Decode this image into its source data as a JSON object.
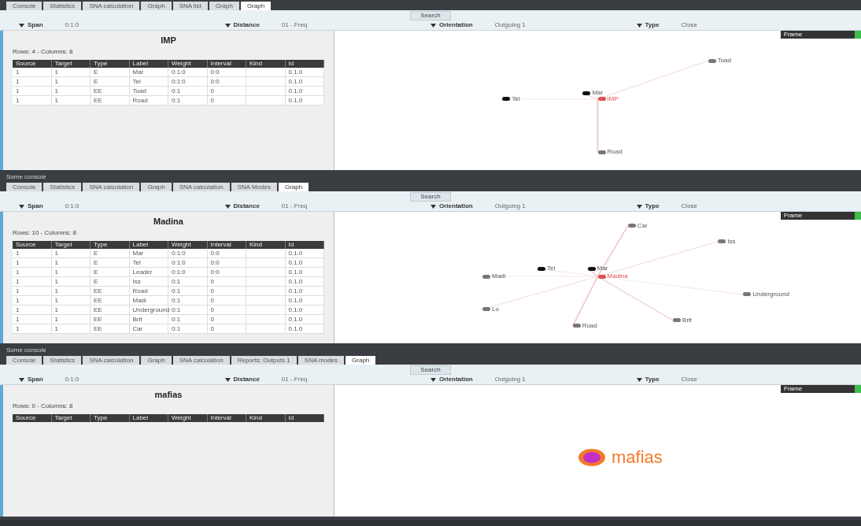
{
  "panels": [
    {
      "tabs": [
        {
          "label": "Console",
          "selected": false
        },
        {
          "label": "Statistics",
          "selected": false
        },
        {
          "label": "SNA calculation",
          "selected": false
        },
        {
          "label": "Graph",
          "selected": false
        },
        {
          "label": "SNA list",
          "selected": false
        },
        {
          "label": "Graph",
          "selected": false
        },
        {
          "label": "Graph",
          "selected": true
        }
      ],
      "search_button": "Search",
      "filters": [
        {
          "label": "Span",
          "value": "0:1:0"
        },
        {
          "label": "Distance",
          "value": "01 - Freq"
        },
        {
          "label": "Orientation",
          "value": "Outgoing 1"
        },
        {
          "label": "Type",
          "value": "Close"
        }
      ],
      "frame_label": "Frame",
      "heading": "IMP",
      "summary": "Rows: 4 - Columns: 8",
      "columns": [
        "Source",
        "Target",
        "Type",
        "Label",
        "Weight",
        "Interval",
        "Kind",
        "Id"
      ],
      "rows": [
        [
          "1",
          "1",
          "E",
          "Mar",
          "0:1:0",
          "0:0",
          "",
          "0.1.0"
        ],
        [
          "1",
          "1",
          "E",
          "Tel",
          "0:1:0",
          "0:0",
          "",
          "0.1.0"
        ],
        [
          "1",
          "1",
          "EE",
          "Toad",
          "0:1",
          "0",
          "",
          "0.1.0"
        ],
        [
          "1",
          "1",
          "EE",
          "Road",
          "0:1",
          "0",
          "",
          "0.1.0"
        ]
      ],
      "nodes": [
        {
          "label": "Toad",
          "kind": "grey"
        },
        {
          "label": "Mar",
          "kind": "dark"
        },
        {
          "label": "Tel",
          "kind": "dark"
        },
        {
          "label": "Road",
          "kind": "grey"
        },
        {
          "label": "IMP",
          "kind": "center"
        }
      ]
    },
    {
      "console_title": "Some console",
      "tabs": [
        {
          "label": "Console",
          "selected": false
        },
        {
          "label": "Statistics",
          "selected": false
        },
        {
          "label": "SNA calculation",
          "selected": false
        },
        {
          "label": "Graph",
          "selected": false
        },
        {
          "label": "SNA calculation",
          "selected": false
        },
        {
          "label": "SNA Modes",
          "selected": false
        },
        {
          "label": "Graph",
          "selected": true
        }
      ],
      "search_button": "Search",
      "filters": [
        {
          "label": "Span",
          "value": "0:1:0"
        },
        {
          "label": "Distance",
          "value": "01 - Freq"
        },
        {
          "label": "Orientation",
          "value": "Outgoing 1"
        },
        {
          "label": "Type",
          "value": "Close"
        }
      ],
      "frame_label": "Frame",
      "heading": "Madina",
      "summary": "Rows: 10 - Columns: 8",
      "columns": [
        "Source",
        "Target",
        "Type",
        "Label",
        "Weight",
        "Interval",
        "Kind",
        "Id"
      ],
      "rows": [
        [
          "1",
          "1",
          "E",
          "Mar",
          "0:1:0",
          "0:0",
          "",
          "0.1.0"
        ],
        [
          "1",
          "1",
          "E",
          "Tel",
          "0:1:0",
          "0:0",
          "",
          "0.1.0"
        ],
        [
          "1",
          "1",
          "E",
          "Leader",
          "0:1:0",
          "0:0",
          "",
          "0.1.0"
        ],
        [
          "1",
          "1",
          "E",
          "Iss",
          "0:1",
          "0",
          "",
          "0.1.0"
        ],
        [
          "1",
          "1",
          "EE",
          "Road",
          "0:1",
          "0",
          "",
          "0.1.0"
        ],
        [
          "1",
          "1",
          "EE",
          "Madi",
          "0:1",
          "0",
          "",
          "0.1.0"
        ],
        [
          "1",
          "1",
          "EE",
          "Underground",
          "0:1",
          "0",
          "",
          "0.1.0"
        ],
        [
          "1",
          "1",
          "EE",
          "Brit",
          "0:1",
          "0",
          "",
          "0.1.0"
        ],
        [
          "1",
          "1",
          "EE",
          "Car",
          "0:1",
          "0",
          "",
          "0.1.0"
        ]
      ],
      "nodes": [
        {
          "label": "Car",
          "kind": "grey"
        },
        {
          "label": "Iss",
          "kind": "grey"
        },
        {
          "label": "Tel",
          "kind": "dark"
        },
        {
          "label": "Mar",
          "kind": "dark"
        },
        {
          "label": "Madi",
          "kind": "grey"
        },
        {
          "label": "Underground",
          "kind": "grey"
        },
        {
          "label": "Lo",
          "kind": "grey"
        },
        {
          "label": "Road",
          "kind": "grey"
        },
        {
          "label": "Brit",
          "kind": "grey"
        },
        {
          "label": "Madina",
          "kind": "center"
        }
      ]
    },
    {
      "console_title": "Some console",
      "tabs": [
        {
          "label": "Console",
          "selected": false
        },
        {
          "label": "Statistics",
          "selected": false
        },
        {
          "label": "SNA calculation",
          "selected": false
        },
        {
          "label": "Graph",
          "selected": false
        },
        {
          "label": "SNA calculation",
          "selected": false
        },
        {
          "label": "Reports: Outputs 1",
          "selected": false
        },
        {
          "label": "SNA modes",
          "selected": false
        },
        {
          "label": "Graph",
          "selected": true
        }
      ],
      "search_button": "Search",
      "filters": [
        {
          "label": "Span",
          "value": "0:1:0"
        },
        {
          "label": "Distance",
          "value": "01 - Freq"
        },
        {
          "label": "Orientation",
          "value": "Outgoing 1"
        },
        {
          "label": "Type",
          "value": "Close"
        }
      ],
      "frame_label": "Frame",
      "heading": "mafias",
      "summary": "Rows: 0 - Columns: 8",
      "columns": [
        "Source",
        "Target",
        "Type",
        "Label",
        "Weight",
        "Interval",
        "Kind",
        "Id"
      ],
      "logo": "mafias"
    }
  ]
}
